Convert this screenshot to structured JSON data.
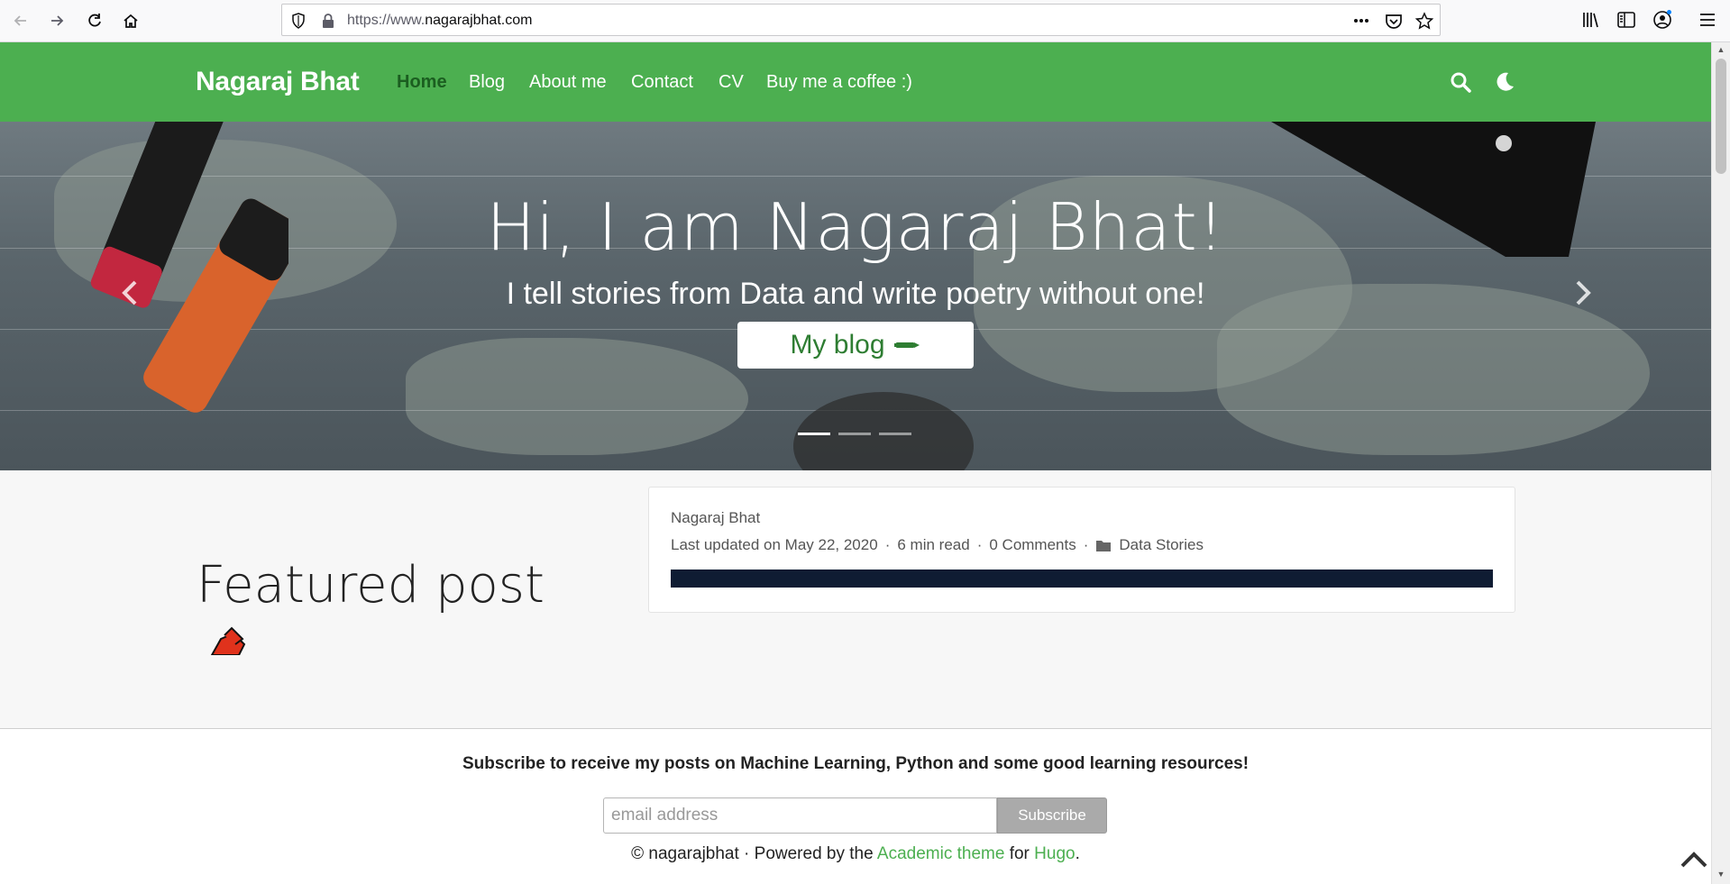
{
  "browser": {
    "url_prefix": "https://www.",
    "url_domain": "nagarajbhat.com",
    "icons": [
      "back-arrow-icon",
      "forward-arrow-icon",
      "reload-icon",
      "home-icon",
      "shield-icon",
      "lock-icon",
      "more-dots-icon",
      "pocket-icon",
      "star-icon",
      "library-icon",
      "sidebar-icon",
      "account-icon",
      "menu-icon"
    ]
  },
  "navbar": {
    "brand": "Nagaraj Bhat",
    "links": [
      "Home",
      "Blog",
      "About me",
      "Contact",
      "CV",
      "Buy me a coffee :)"
    ],
    "active": "Home",
    "color": "#4caf50"
  },
  "hero": {
    "title": "Hi, I am Nagaraj Bhat!",
    "subtitle": "I tell stories from Data and write poetry without one!",
    "button": "My blog"
  },
  "featured": {
    "heading": "Featured post",
    "author": "Nagaraj Bhat",
    "updated": "Last updated on May 22, 2020",
    "read_time": "6 min read",
    "comments": "0 Comments",
    "category": "Data Stories"
  },
  "subscribe": {
    "text": "Subscribe to receive my posts on Machine Learning, Python and some good learning resources!",
    "placeholder": "email address",
    "button": "Subscribe"
  },
  "footer": {
    "prefix": "© nagarajbhat · Powered by the ",
    "theme_link": "Academic theme",
    "middle": " for ",
    "hugo_link": "Hugo",
    "suffix": "."
  }
}
